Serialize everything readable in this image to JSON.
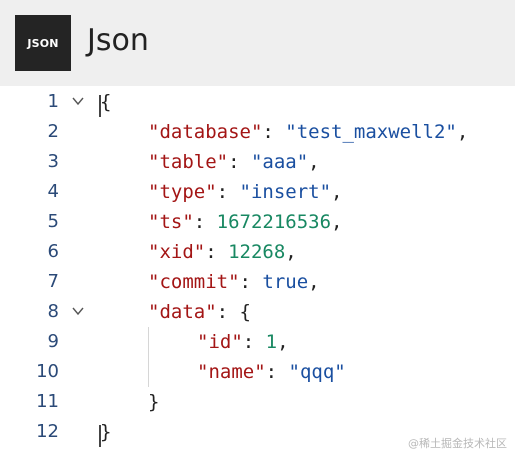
{
  "header": {
    "logo_text": "JSON",
    "title": "Json"
  },
  "editor": {
    "lines": [
      {
        "number": "1",
        "foldable": true
      },
      {
        "number": "2"
      },
      {
        "number": "3"
      },
      {
        "number": "4"
      },
      {
        "number": "5"
      },
      {
        "number": "6"
      },
      {
        "number": "7"
      },
      {
        "number": "8",
        "foldable": true
      },
      {
        "number": "9"
      },
      {
        "number": "10"
      },
      {
        "number": "11"
      },
      {
        "number": "12"
      }
    ],
    "tokens": {
      "open_brace": "{",
      "close_brace": "}",
      "colon": ": ",
      "comma": ",",
      "database_key": "\"database\"",
      "database_value": "\"test_maxwell2\"",
      "table_key": "\"table\"",
      "table_value": "\"aaa\"",
      "type_key": "\"type\"",
      "type_value": "\"insert\"",
      "ts_key": "\"ts\"",
      "ts_value": "1672216536",
      "xid_key": "\"xid\"",
      "xid_value": "12268",
      "commit_key": "\"commit\"",
      "commit_value": "true",
      "data_key": "\"data\"",
      "id_key": "\"id\"",
      "id_value": "1",
      "name_key": "\"name\"",
      "name_value": "\"qqq\""
    }
  },
  "watermark": "@稀土掘金技术社区",
  "colors": {
    "key": "#a31515",
    "string": "#1a4fa0",
    "number": "#188862",
    "line_number": "#2b4a78",
    "header_bg": "#efefef",
    "logo_bg": "#242424"
  },
  "icons": {
    "logo": "json-logo",
    "fold": "chevron-down-icon"
  }
}
